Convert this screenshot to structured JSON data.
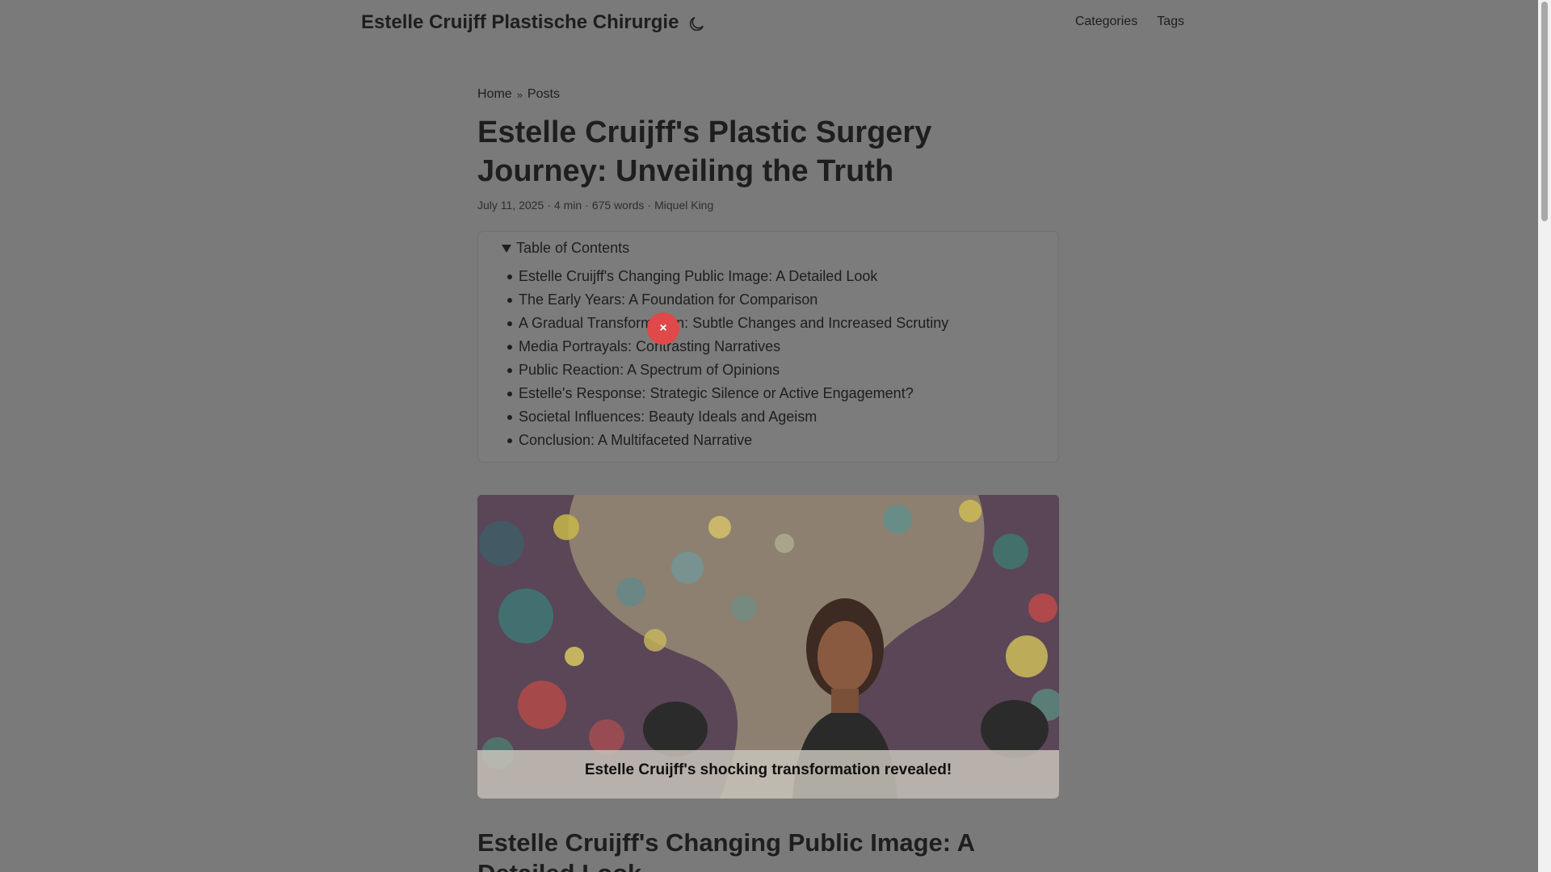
{
  "header": {
    "site_title": "Estelle Cruijff Plastische Chirurgie",
    "theme_toggle_icon": "moon-icon",
    "nav": [
      "Categories",
      "Tags"
    ]
  },
  "breadcrumbs": {
    "home": "Home",
    "separator": "»",
    "posts": "Posts"
  },
  "post": {
    "title": "Estelle Cruijff's Plastic Surgery Journey: Unveiling the Truth",
    "meta": {
      "date": "July 11, 2025",
      "reading_time": "4 min",
      "words": "675 words",
      "author": "Miquel King",
      "separator": "·"
    }
  },
  "toc": {
    "summary": "Table of Contents",
    "items": [
      "Estelle Cruijff's Changing Public Image: A Detailed Look",
      "The Early Years: A Foundation for Comparison",
      "A Gradual Transformation: Subtle Changes and Increased Scrutiny",
      "Media Portrayals: Contrasting Narratives",
      "Public Reaction: A Spectrum of Opinions",
      "Estelle's Response: Strategic Silence or Active Engagement?",
      "Societal Influences: Beauty Ideals and Ageism",
      "Conclusion: A Multifaceted Narrative"
    ]
  },
  "overlay": {
    "close_label": "×",
    "color": "#e0484a"
  },
  "cover": {
    "caption": "Estelle Cruijff's shocking transformation revealed!"
  },
  "first_section": {
    "heading": "Estelle Cruijff's Changing Public Image: A Detailed Look"
  }
}
